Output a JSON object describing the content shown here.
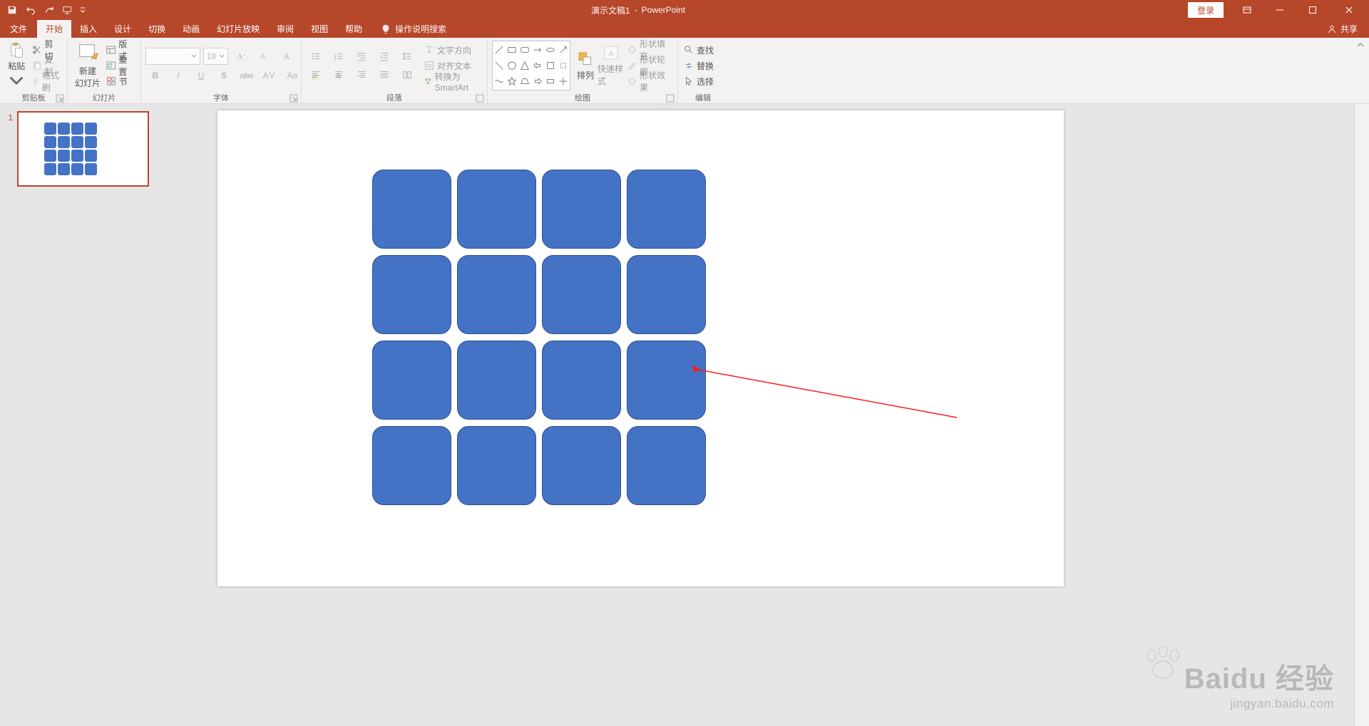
{
  "app": {
    "doc_name": "演示文稿1",
    "app_name": "PowerPoint",
    "login": "登录",
    "share": "共享"
  },
  "tabs": {
    "items": [
      "文件",
      "开始",
      "插入",
      "设计",
      "切换",
      "动画",
      "幻灯片放映",
      "审阅",
      "视图",
      "帮助"
    ],
    "active_index": 1,
    "tell_me": "操作说明搜索"
  },
  "ribbon": {
    "clipboard": {
      "label": "剪贴板",
      "paste": "粘贴",
      "cut": "剪切",
      "copy": "复制",
      "format_painter": "格式刷"
    },
    "slides": {
      "label": "幻灯片",
      "new_slide_l1": "新建",
      "new_slide_l2": "幻灯片",
      "layout": "版式",
      "reset": "重置",
      "section": "节"
    },
    "font": {
      "label": "字体",
      "name_placeholder": "",
      "size_placeholder": "18"
    },
    "paragraph": {
      "label": "段落",
      "text_direction": "文字方向",
      "align_text": "对齐文本",
      "convert_smartart": "转换为 SmartArt"
    },
    "drawing": {
      "label": "绘图",
      "arrange": "排列",
      "quick_styles": "快速样式",
      "shape_fill": "形状填充",
      "shape_outline": "形状轮廓",
      "shape_effects": "形状效果"
    },
    "editing": {
      "label": "编辑",
      "find": "查找",
      "replace": "替换",
      "select": "选择"
    }
  },
  "thumbs": {
    "items": [
      {
        "num": "1"
      }
    ]
  },
  "watermark": {
    "brand": "Baidu 经验",
    "url": "jingyan.baidu.com"
  }
}
